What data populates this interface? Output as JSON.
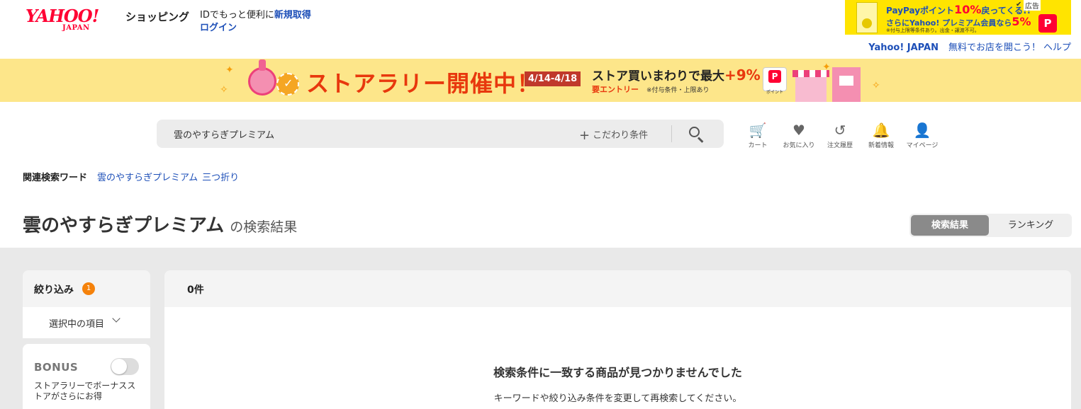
{
  "header": {
    "logo_brand": "YAHOO!",
    "logo_sub": "JAPAN",
    "service_name": "ショッピング",
    "id_prompt": "IDでもっと便利に",
    "signup_link": "新規取得",
    "login_link": "ログイン",
    "links": {
      "yahoo_japan": "Yahoo! JAPAN",
      "open_store": "無料でお店を開こう！",
      "help": "ヘルプ"
    }
  },
  "ad": {
    "label": "広告",
    "line1_prefix": "PayPayポイント",
    "line1_big": "10%",
    "line1_suffix": "戻ってくる!!",
    "line2_prefix": "さらにYahoo! プレミアム会員なら",
    "line2_big": "5%",
    "note": "※付与上限等条件あり。出金・譲渡不可。",
    "paypay_glyph": "P"
  },
  "campaign": {
    "title": "ストアラリー開催中！",
    "dates": "4/14-4/18",
    "subtitle": "ストア買いまわりで最大",
    "bonus": "+9%",
    "entry_required": "要エントリー",
    "note": "※付与条件・上限あり",
    "paypay_label": "ポイント"
  },
  "search": {
    "query": "雲のやすらぎプレミアム",
    "advanced_label": "こだわり条件"
  },
  "nav": [
    {
      "icon": "cart-icon",
      "glyph": "🛒",
      "label": "カート"
    },
    {
      "icon": "heart-icon",
      "glyph": "♥",
      "label": "お気に入り"
    },
    {
      "icon": "history-icon",
      "glyph": "↺",
      "label": "注文履歴"
    },
    {
      "icon": "bell-icon",
      "glyph": "🔔",
      "label": "新着情報"
    },
    {
      "icon": "person-icon",
      "glyph": "👤",
      "label": "マイページ"
    }
  ],
  "related": {
    "label": "関連検索ワード",
    "words": [
      "雲のやすらぎプレミアム",
      "三つ折り"
    ]
  },
  "results": {
    "keyword": "雲のやすらぎプレミアム",
    "suffix": "の検索結果",
    "tabs": [
      "検索結果",
      "ランキング"
    ],
    "active_tab": "検索結果",
    "count": "0件",
    "empty_title": "検索条件に一致する商品が見つかりませんでした",
    "empty_sub": "キーワードや絞り込み条件を変更して再検索してください。"
  },
  "filter": {
    "title": "絞り込み",
    "badge": "1",
    "selected_label": "選択中の項目",
    "bonus_logo": "BONUS",
    "bonus_toggle_on": false,
    "bonus_text": "ストアラリーでボーナスストアがさらにお得"
  },
  "colors": {
    "brand_red": "#ff0033",
    "link_blue": "#1d4fb8",
    "campaign_bg": "#fde68a",
    "badge_orange": "#f5820b"
  }
}
